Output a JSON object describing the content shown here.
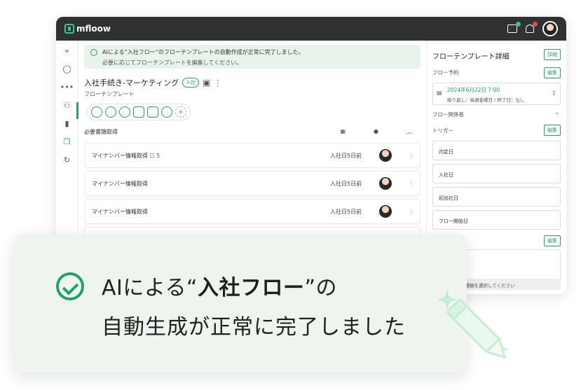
{
  "app": {
    "brand": "mfloow"
  },
  "banner": {
    "line1": "AIによる“入社フロー”のフローテンプレートの自動作成が正常に完了しました。",
    "line2": "必要に応じてフローテンプレートを編集してください。"
  },
  "flow": {
    "title": "入社手続き-マーケティング",
    "tag": "入社",
    "subtitle": "フローテンプレート",
    "section": "必要書類取得"
  },
  "rows": [
    {
      "name": "マイナンバー情報取得",
      "count": "5",
      "date": "入社日5日前"
    },
    {
      "name": "マイナンバー情報取得",
      "count": "",
      "date": "入社日5日前"
    },
    {
      "name": "マイナンバー情報取得",
      "count": "",
      "date": "入社日5日前"
    }
  ],
  "right_panel": {
    "title": "フローテンプレート詳細",
    "detail_btn": "詳細",
    "reserve_label": "フロー予約",
    "edit_btn": "編集",
    "schedule_date": "2024年6月22日 7:00",
    "schedule_repeat": "繰り返し：毎週金曜日 / 終了日：なし",
    "members_label": "フロー関係者",
    "trigger_label": "トリガー",
    "triggers": [
      "内定日",
      "入社日",
      "初出社日",
      "フロー開始日"
    ],
    "select_hint": "の種類を選択してください"
  },
  "overlay": {
    "prefix": "AIによる“",
    "highlight": "入社フロー",
    "suffix": "”の",
    "line2": "自動生成が正常に完了しました"
  },
  "colors": {
    "accent": "#22a06b",
    "topbar": "#2f3133",
    "card_bg": "#eef5ef"
  }
}
